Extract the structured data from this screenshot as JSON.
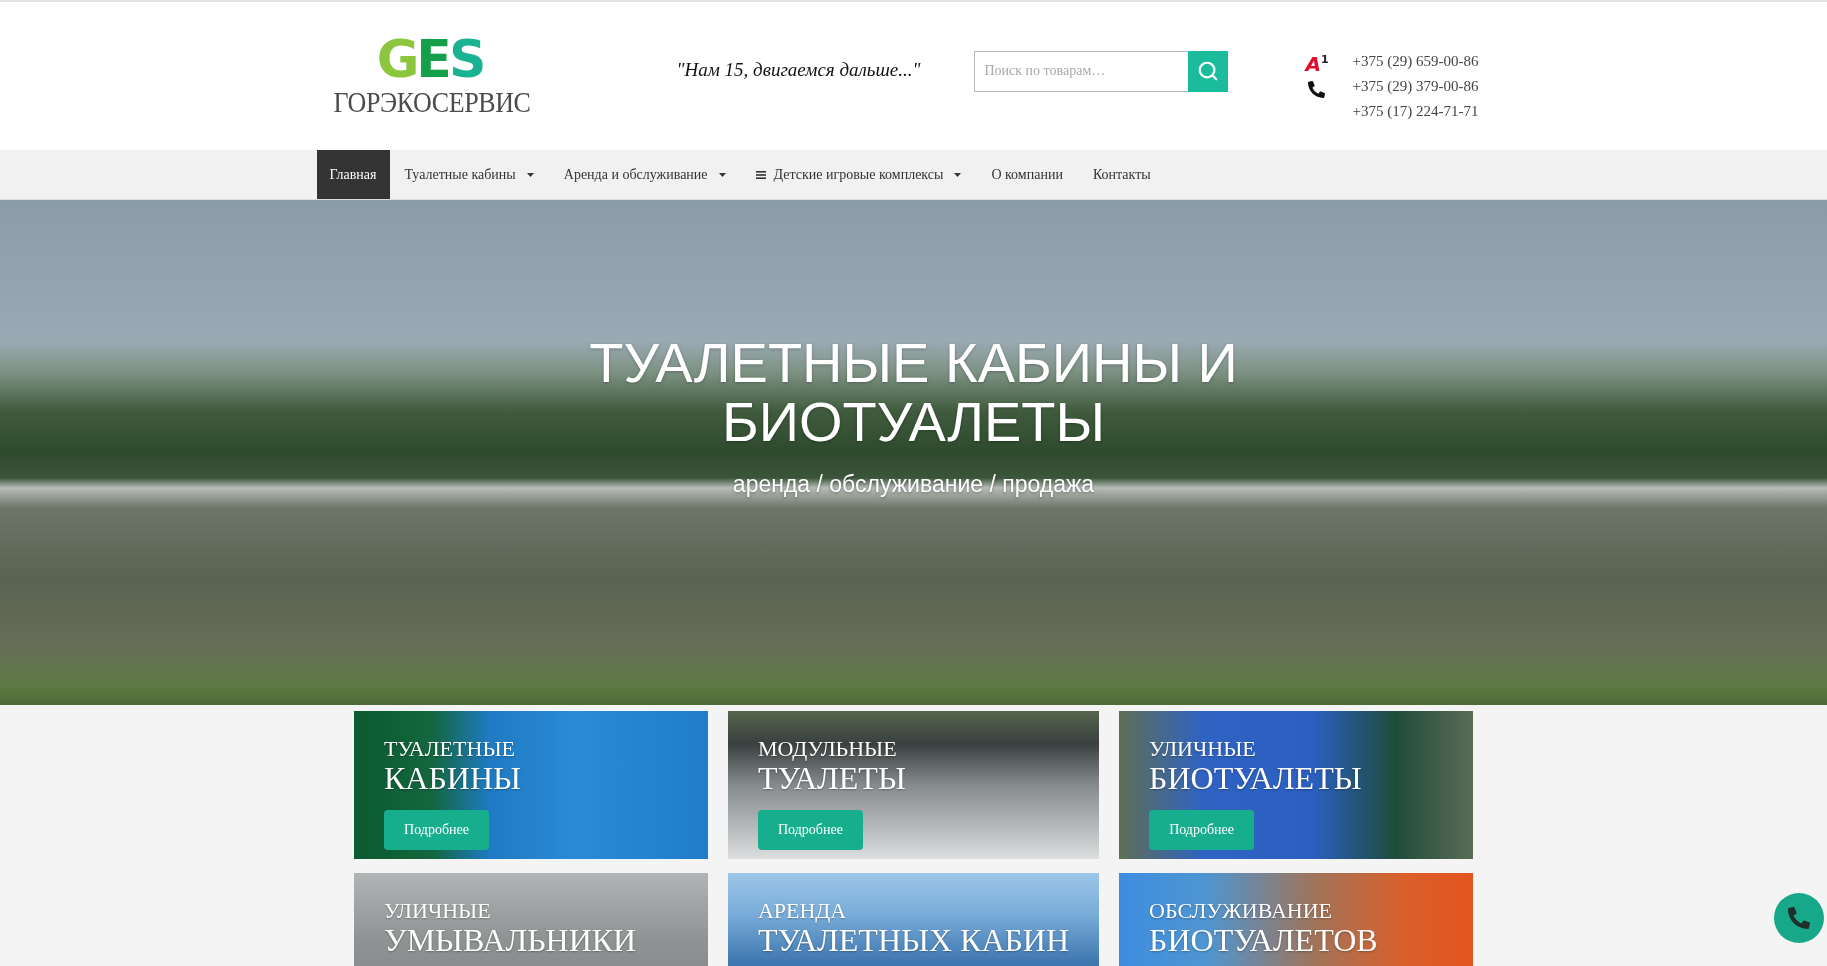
{
  "header": {
    "logo": {
      "mark": "GES",
      "name": "ГОРЭКОСЕРВИС"
    },
    "tagline": "\"Нам 15, двигаемся дальше...\"",
    "search": {
      "placeholder": "Поиск по товарам…"
    },
    "contacts": {
      "operator_logo": "A$^{1}$",
      "phones": [
        "+375 (29) 659-00-86",
        "+375 (29) 379-00-86",
        "+375 (17) 224-71-71"
      ]
    }
  },
  "nav": [
    {
      "label": "Главная",
      "selected": true,
      "dropdown": false,
      "list_icon": false
    },
    {
      "label": "Туалетные кабины",
      "selected": false,
      "dropdown": true,
      "list_icon": false
    },
    {
      "label": "Аренда и обслуживание",
      "selected": false,
      "dropdown": true,
      "list_icon": false
    },
    {
      "label": "Детские игровые комплексы",
      "selected": false,
      "dropdown": true,
      "list_icon": true
    },
    {
      "label": "О компании",
      "selected": false,
      "dropdown": false,
      "list_icon": false
    },
    {
      "label": "Контакты",
      "selected": false,
      "dropdown": false,
      "list_icon": false
    }
  ],
  "hero": {
    "title": "ТУАЛЕТНЫЕ КАБИНЫ И БИОТУАЛЕТЫ",
    "subtitle": "аренда / обслуживание / продажа"
  },
  "cards": [
    {
      "line_1": "ТУАЛЕТНЫЕ",
      "line_2": "КАБИНЫ",
      "button": "Подробнее"
    },
    {
      "line_1": "МОДУЛЬНЫЕ",
      "line_2": "ТУАЛЕТЫ",
      "button": "Подробнее"
    },
    {
      "line_1": "УЛИЧНЫЕ",
      "line_2": "БИОТУАЛЕТЫ",
      "button": "Подробнее"
    },
    {
      "line_1": "УЛИЧНЫЕ",
      "line_2": "УМЫВАЛЬНИКИ"
    },
    {
      "line_1": "АРЕНДА",
      "line_2": "ТУАЛЕТНЫХ КАБИН"
    },
    {
      "line_1": "ОБСЛУЖИВАНИЕ",
      "line_2": "БИОТУАЛЕТОВ"
    }
  ]
}
